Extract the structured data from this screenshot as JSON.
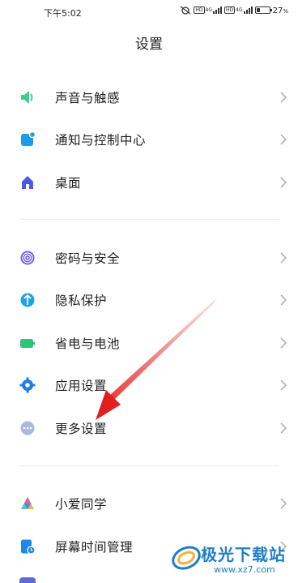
{
  "status_bar": {
    "time": "下午5:02",
    "sim1_hd": "HD",
    "sim1_net": "4G",
    "sim2_hd": "HD",
    "sim2_net": "4G",
    "battery_percent": "27",
    "battery_unit": "%",
    "battery_level": 0.27
  },
  "header": {
    "title": "设置"
  },
  "groups": [
    {
      "items": [
        {
          "label": "声音与触感",
          "icon": "speaker-icon",
          "color": "#3dcf8e"
        },
        {
          "label": "通知与控制中心",
          "icon": "notification-icon",
          "color": "#1e9be8"
        },
        {
          "label": "桌面",
          "icon": "home-icon",
          "color": "#4a5be8"
        }
      ]
    },
    {
      "items": [
        {
          "label": "密码与安全",
          "icon": "fingerprint-icon",
          "color": "#6e5fe8"
        },
        {
          "label": "隐私保护",
          "icon": "privacy-shield-icon",
          "color": "#1aa3e6"
        },
        {
          "label": "省电与电池",
          "icon": "battery-icon",
          "color": "#28c77a"
        },
        {
          "label": "应用设置",
          "icon": "gear-icon",
          "color": "#1e7fe0"
        },
        {
          "label": "更多设置",
          "icon": "more-icon",
          "color": "#8fa3d8"
        }
      ]
    },
    {
      "items": [
        {
          "label": "小爱同学",
          "icon": "xiaoai-icon",
          "color": "#5b7cf0"
        },
        {
          "label": "屏幕时间管理",
          "icon": "screen-time-icon",
          "color": "#1e88e5"
        }
      ]
    }
  ],
  "watermark": {
    "text": "极光下载站",
    "url": "www.xz7.com"
  }
}
